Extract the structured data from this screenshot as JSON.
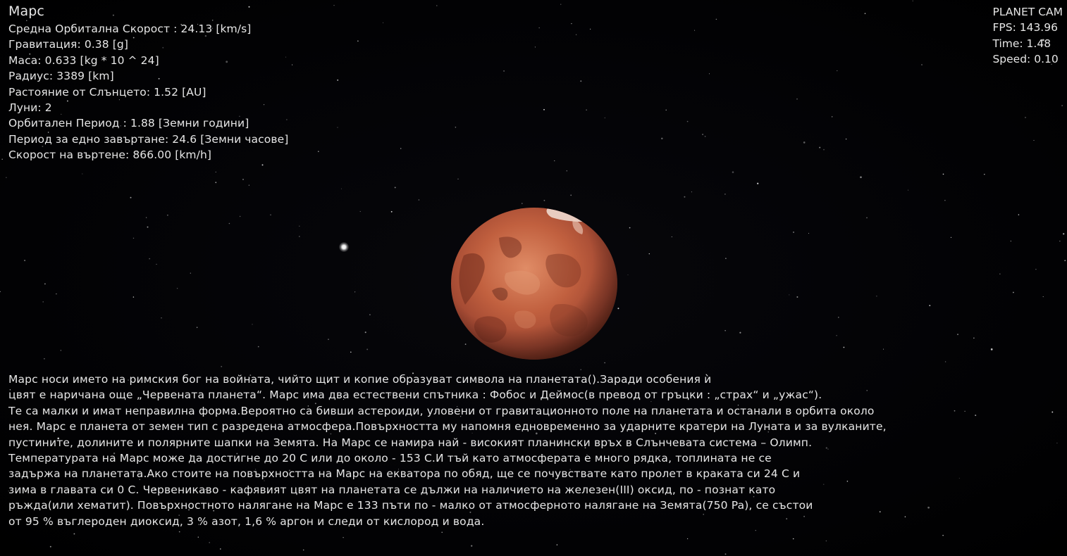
{
  "planet": {
    "name": "Марс",
    "stats": [
      "Средна Орбитална Скорост : 24.13 [km/s]",
      "Гравитация: 0.38 [g]",
      "Маса: 0.633 [kg * 10 ^ 24]",
      "Радиус: 3389 [km]",
      "Растояние от Слънцето: 1.52 [AU]",
      "Луни: 2",
      "Орбитален Период : 1.88 [Земни години]",
      "Период за едно завъртане:  24.6 [Земни часове]",
      "Скорост на въртене: 866.00 [km/h]"
    ]
  },
  "camera": {
    "mode": "PLANET CAM",
    "fps": "FPS: 143.96",
    "time": "Time: 1.48",
    "speed": "Speed: 0.10"
  },
  "description": [
    "Марс носи името на римския бог на войната, чийто щит и копие образуват символа на планетата().Заради особения ѝ",
    "цвят е наричана още „Червената планета“. Марс има два естествени спътника : Фобос и Деймос(в превод от гръцки : „страх“ и „ужас“).",
    "Те са малки и имат неправилна форма.Вероятно са бивши астероиди, уловени от гравитационното поле на планетата и останали в орбита около",
    "нея. Марс е планета от земен тип с разредена атмосфера.Повърхността му напомня едновременно за ударните кратери на Луната и за вулканите,",
    "пустините, долините и полярните шапки на Земята. На Марс се намира най - високият планински връх в Слънчевата система – Олимп.",
    "Температурата на Марс може да достигне до 20 С или до около - 153 С.И тъй като атмосферата е много рядка, топлината не се",
    "задържа на планетата.Ако стоите на повърхността на Марс на екватора по обяд, ще се почувствате като пролет в краката си 24 С и",
    "зима в главата си  0 С. Червеникаво - кафявият цвят на планетата се дължи на наличието на железен(III) оксид, по - познат като",
    "ръжда(или хематит). Повърхностното  налягане на Марс е 133 пъти по - малко от атмосферното налягане на Земята(750 Pa), се състои",
    "от 95 % въглероден диоксид, 3 % азот, 1,6 % аргон и следи от кислород и вода."
  ],
  "colors": {
    "background": "#020204",
    "text": "#e6e6e6",
    "planet_base": "#b5553a",
    "planet_light": "#d97a56",
    "planet_dark": "#6e2a1c",
    "moon": "#ffffff"
  },
  "icons": {
    "planet": "mars-planet",
    "moon": "moon-dot",
    "background": "starfield"
  }
}
